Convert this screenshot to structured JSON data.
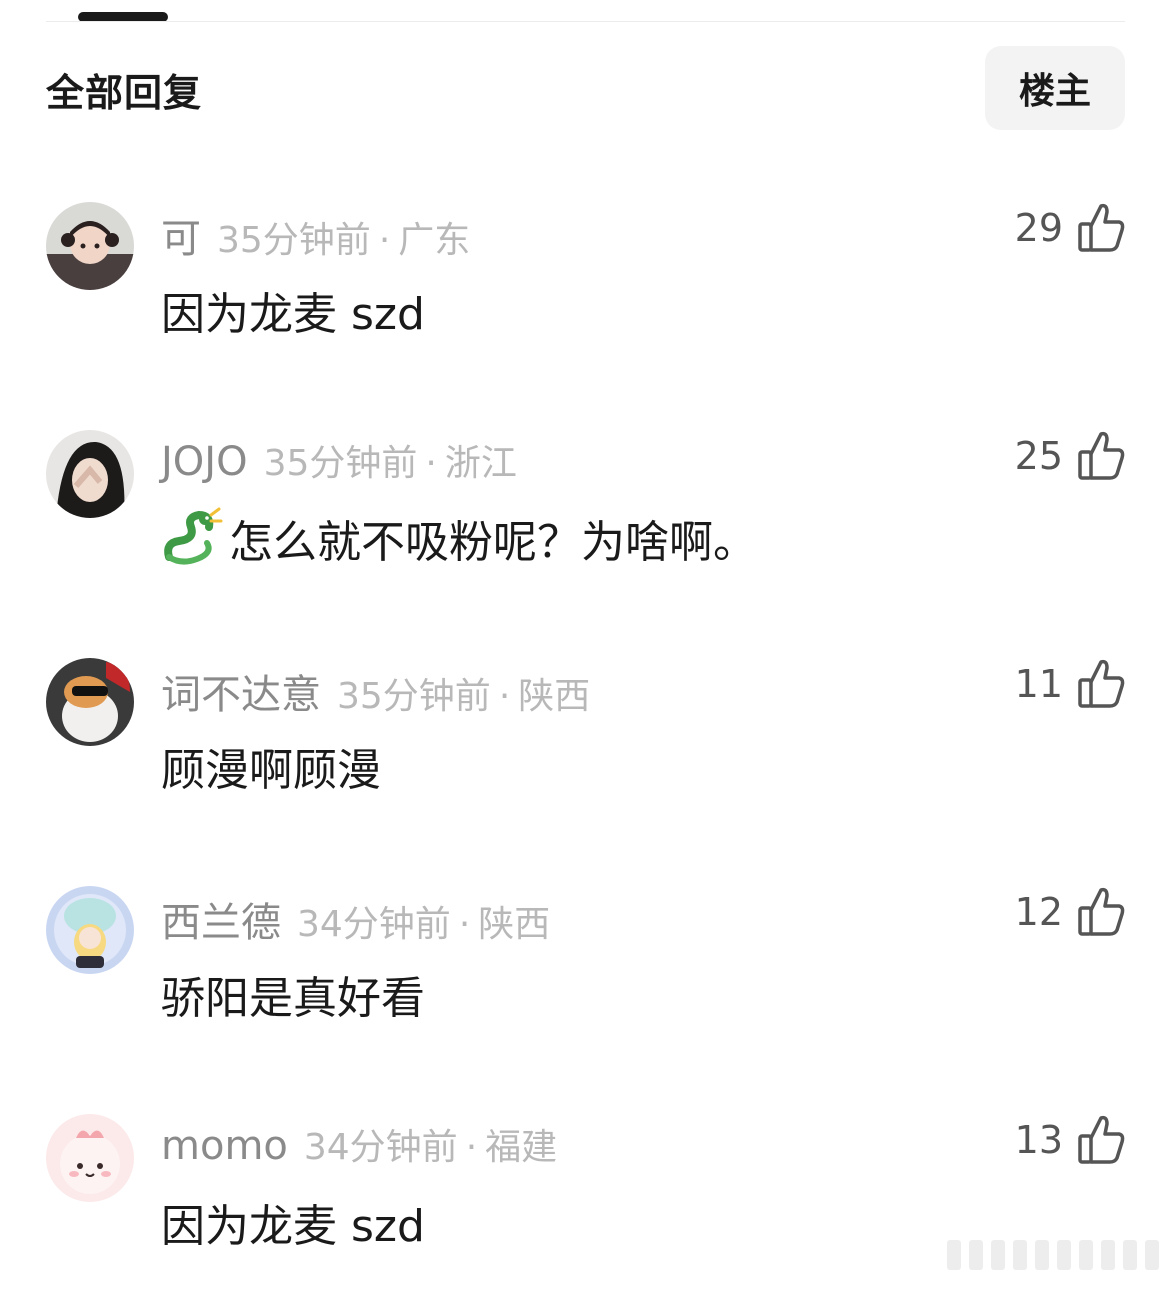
{
  "header": {
    "title": "全部回复",
    "op_button_label": "楼主"
  },
  "comments": [
    {
      "username": "可",
      "time": "35分钟前",
      "separator": "·",
      "region": "广东",
      "content": "因为龙麦 szd",
      "likes": "29"
    },
    {
      "username": "JOJO",
      "time": "35分钟前",
      "separator": "·",
      "region": "浙江",
      "content": "怎么就不吸粉呢？为啥啊。",
      "likes": "25"
    },
    {
      "username": "词不达意",
      "time": "35分钟前",
      "separator": "·",
      "region": "陕西",
      "content": "顾漫啊顾漫",
      "likes": "11"
    },
    {
      "username": "西兰德",
      "time": "34分钟前",
      "separator": "·",
      "region": "陕西",
      "content": "骄阳是真好看",
      "likes": "12"
    },
    {
      "username": "momo",
      "time": "34分钟前",
      "separator": "·",
      "region": "福建",
      "content": "因为龙麦 szd",
      "likes": "13"
    }
  ],
  "icons": {
    "like": "thumbs-up-icon",
    "emoji": "dragon-emoji"
  },
  "colors": {
    "username": "#8a8a8a",
    "meta": "#b8b8b8",
    "content": "#1a1a1a",
    "like_count": "#555555",
    "op_button_bg": "#f3f3f3"
  }
}
